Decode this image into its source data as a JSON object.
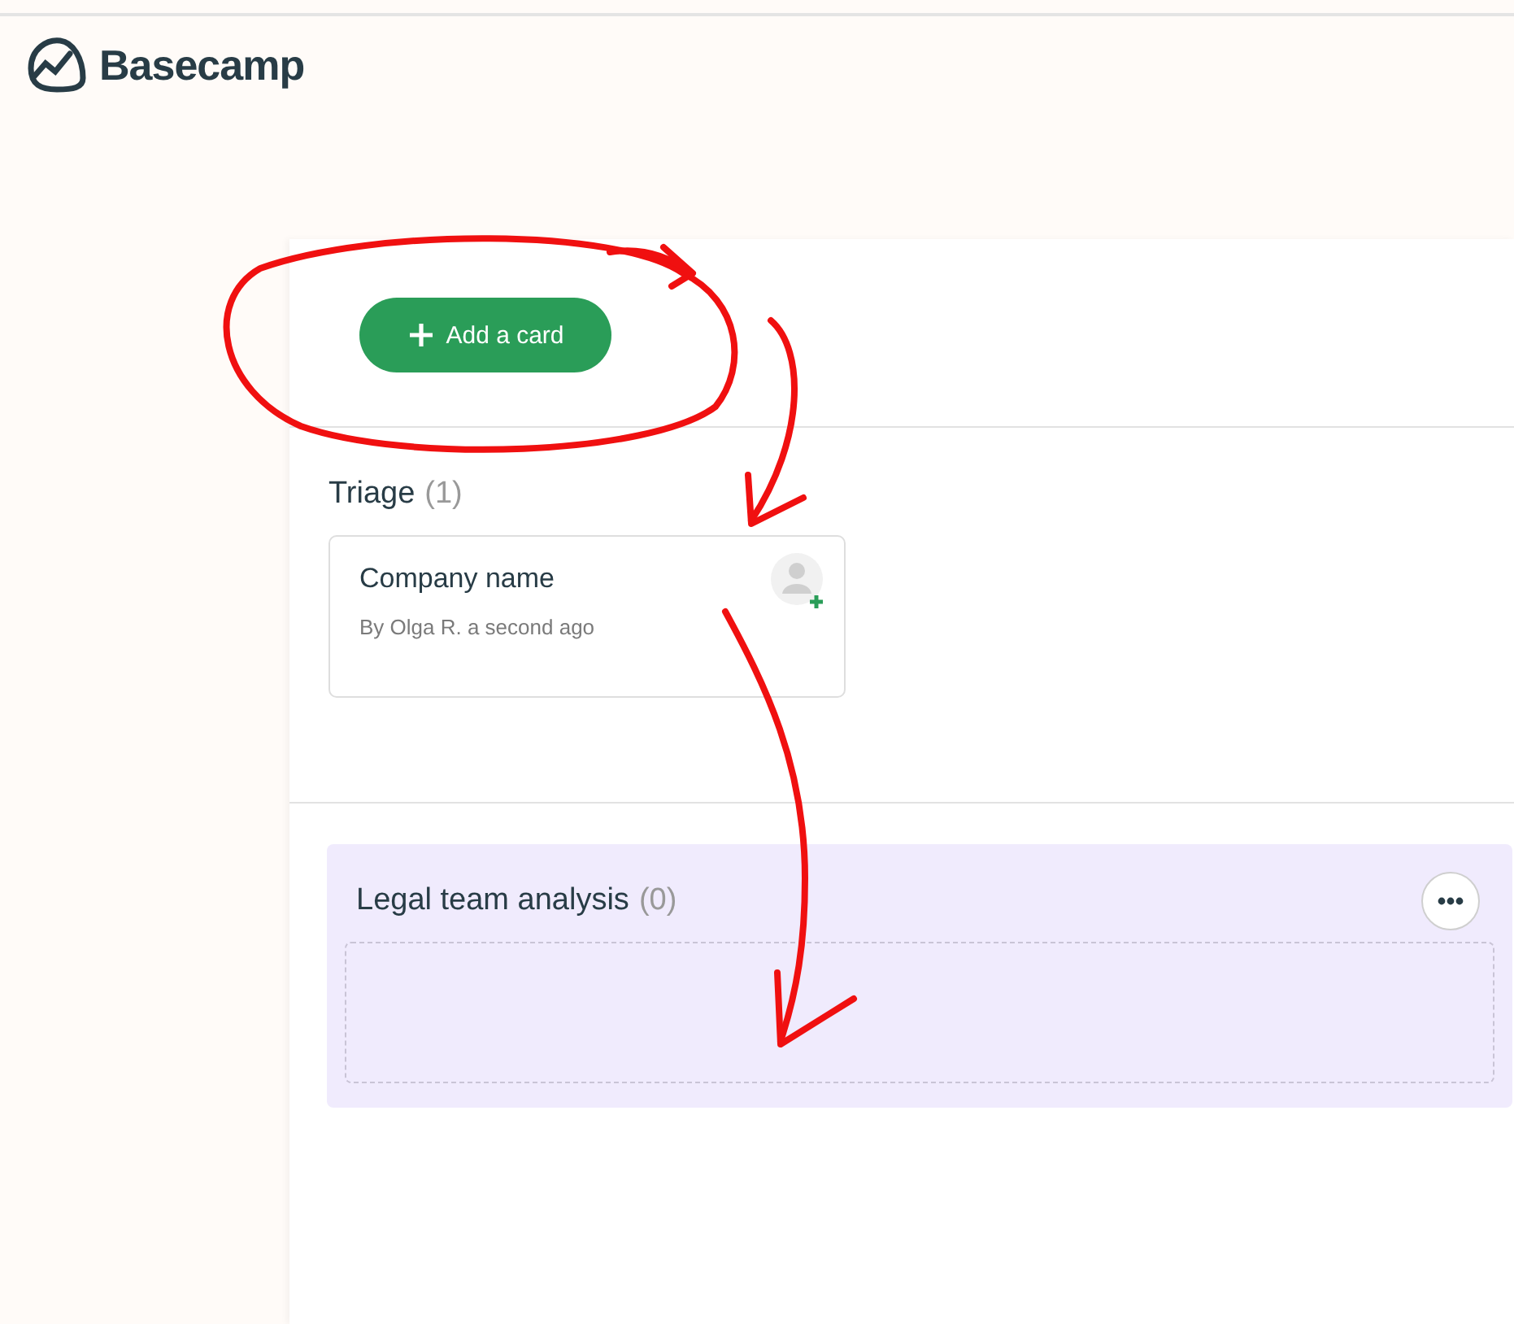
{
  "logo": {
    "text": "Basecamp"
  },
  "add_button": {
    "label": "Add a card"
  },
  "columns": [
    {
      "kind": "plain",
      "title": "Triage",
      "count": "(1)",
      "cards": [
        {
          "title": "Company name",
          "meta": "By Olga R. a second ago"
        }
      ]
    },
    {
      "kind": "highlighted",
      "title": "Legal team analysis",
      "count": "(0)"
    }
  ]
}
